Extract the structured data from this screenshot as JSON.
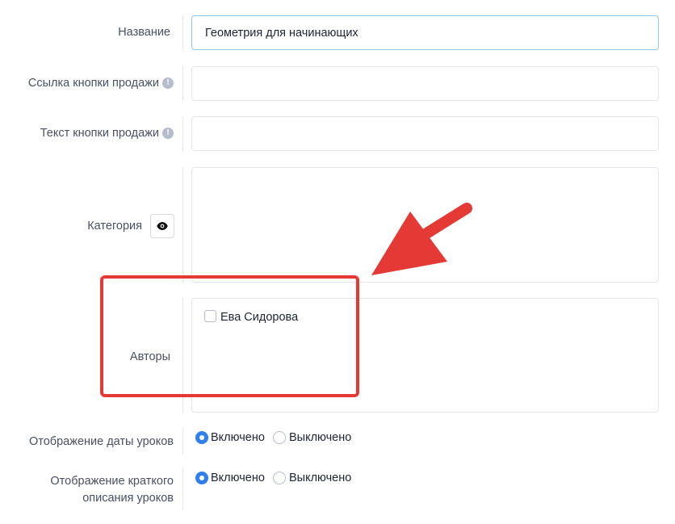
{
  "form": {
    "name": {
      "label": "Название",
      "value": "Геометрия для начинающих"
    },
    "sell_link": {
      "label": "Ссылка кнопки продажи",
      "value": ""
    },
    "sell_text": {
      "label": "Текст кнопки продажи",
      "value": ""
    },
    "category": {
      "label": "Категория"
    },
    "authors": {
      "label": "Авторы",
      "options": [
        "Ева Сидорова"
      ]
    },
    "lesson_date": {
      "label": "Отображение даты уроков",
      "on": "Включено",
      "off": "Выключено",
      "selected": "on"
    },
    "lesson_desc": {
      "label_line1": "Отображение краткого",
      "label_line2": "описания уроков",
      "on": "Включено",
      "off": "Выключено",
      "selected": "on"
    }
  },
  "icons": {
    "info": "info-icon",
    "eye": "eye-icon",
    "info_symbol": "!"
  },
  "colors": {
    "accent": "#2f80ed",
    "annotation": "#e53935",
    "focus_border": "#8ecbe6"
  }
}
